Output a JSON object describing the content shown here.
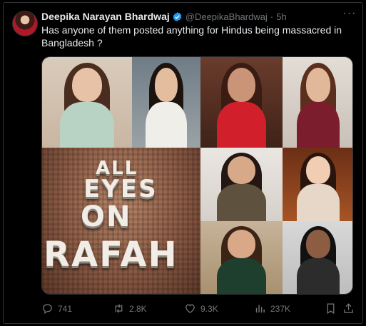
{
  "tweet": {
    "display_name": "Deepika Narayan Bhardwaj",
    "handle": "@DeepikaBhardwaj",
    "separator": "·",
    "time": "5h",
    "text": "Has anyone of them posted anything for Hindus being massacred in Bangladesh ?"
  },
  "media": {
    "rafah_lines": [
      "ALL",
      "EYES",
      "ON",
      "RAFAH"
    ]
  },
  "actions": {
    "replies": "741",
    "reposts": "2.8K",
    "likes": "9.3K",
    "views": "237K"
  },
  "colors": {
    "background": "#000000",
    "text": "#e7e9ea",
    "muted": "#71767b",
    "verified": "#1d9bf0"
  }
}
